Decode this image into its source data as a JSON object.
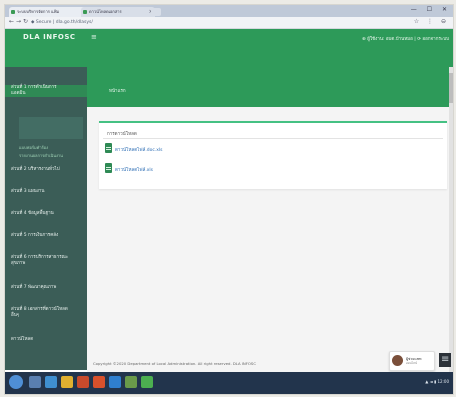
{
  "browser": {
    "tabs": [
      {
        "label": "ระบบบริหารจัดการ แฟ้ม"
      },
      {
        "label": "ดาวน์โหลดเอกสาร"
      }
    ],
    "url": "◆ Secure | dla.go.th/dlasys/",
    "window_controls": "— ☐ ✕",
    "addr_icons": "☆ ⋮ ⊖"
  },
  "header": {
    "brand": "DLA INFOSC",
    "menu_icon": "≡",
    "user_info": "⊕ ผู้ใช้งาน: อบต.บ้านหมอ | ⟳ ออกจากระบบ"
  },
  "sidebar": {
    "items": [
      {
        "label": "ส่วนที่ 1 การดำเนินการ",
        "sub": "แอดมิน"
      },
      {
        "label": "ส่วนที่ 2 บริหารงานทั่วไป"
      },
      {
        "label": "ส่วนที่ 3 แผนงาน"
      },
      {
        "label": "ส่วนที่ 4 ข้อมูลพื้นฐาน"
      },
      {
        "label": "ส่วนที่ 5 การเงินการคลัง"
      },
      {
        "label": "ส่วนที่ 6 การบริการสาธารณะ",
        "sub": "สุขภาพ"
      },
      {
        "label": "ส่วนที่ 7 พัฒนาคุณภาพ"
      },
      {
        "label": "ส่วนที่ 8 เอกสารที่ดาวน์โหลด",
        "sub": "อื่นๆ"
      },
      {
        "label": "ดาวน์โหลด"
      }
    ],
    "sub_links": [
      {
        "label": "แบบฟอร์มคำร้อง"
      },
      {
        "label": "รายงานผลการดำเนินงาน"
      }
    ]
  },
  "content": {
    "breadcrumb": "หน้าแรก",
    "card_title": "การดาวน์โหลด",
    "files": [
      {
        "label": "ดาวน์โหลดไฟล์.doc.xls"
      },
      {
        "label": "ดาวน์โหลดไฟล์.xls"
      }
    ]
  },
  "footer": {
    "copyright": "Copyright ©2020 Department of Local Administration. All right reserved. DLA INFOSC"
  },
  "chat": {
    "name": "ผู้ช่วยแชท",
    "status": "ออนไลน์"
  },
  "taskbar": {
    "tray": "▲ ◄ ▮  12:00"
  },
  "colors": {
    "header_green": "#2d9a59",
    "sidebar": "#3b5d57",
    "accent": "#45c183",
    "link": "#2f6fb5"
  }
}
